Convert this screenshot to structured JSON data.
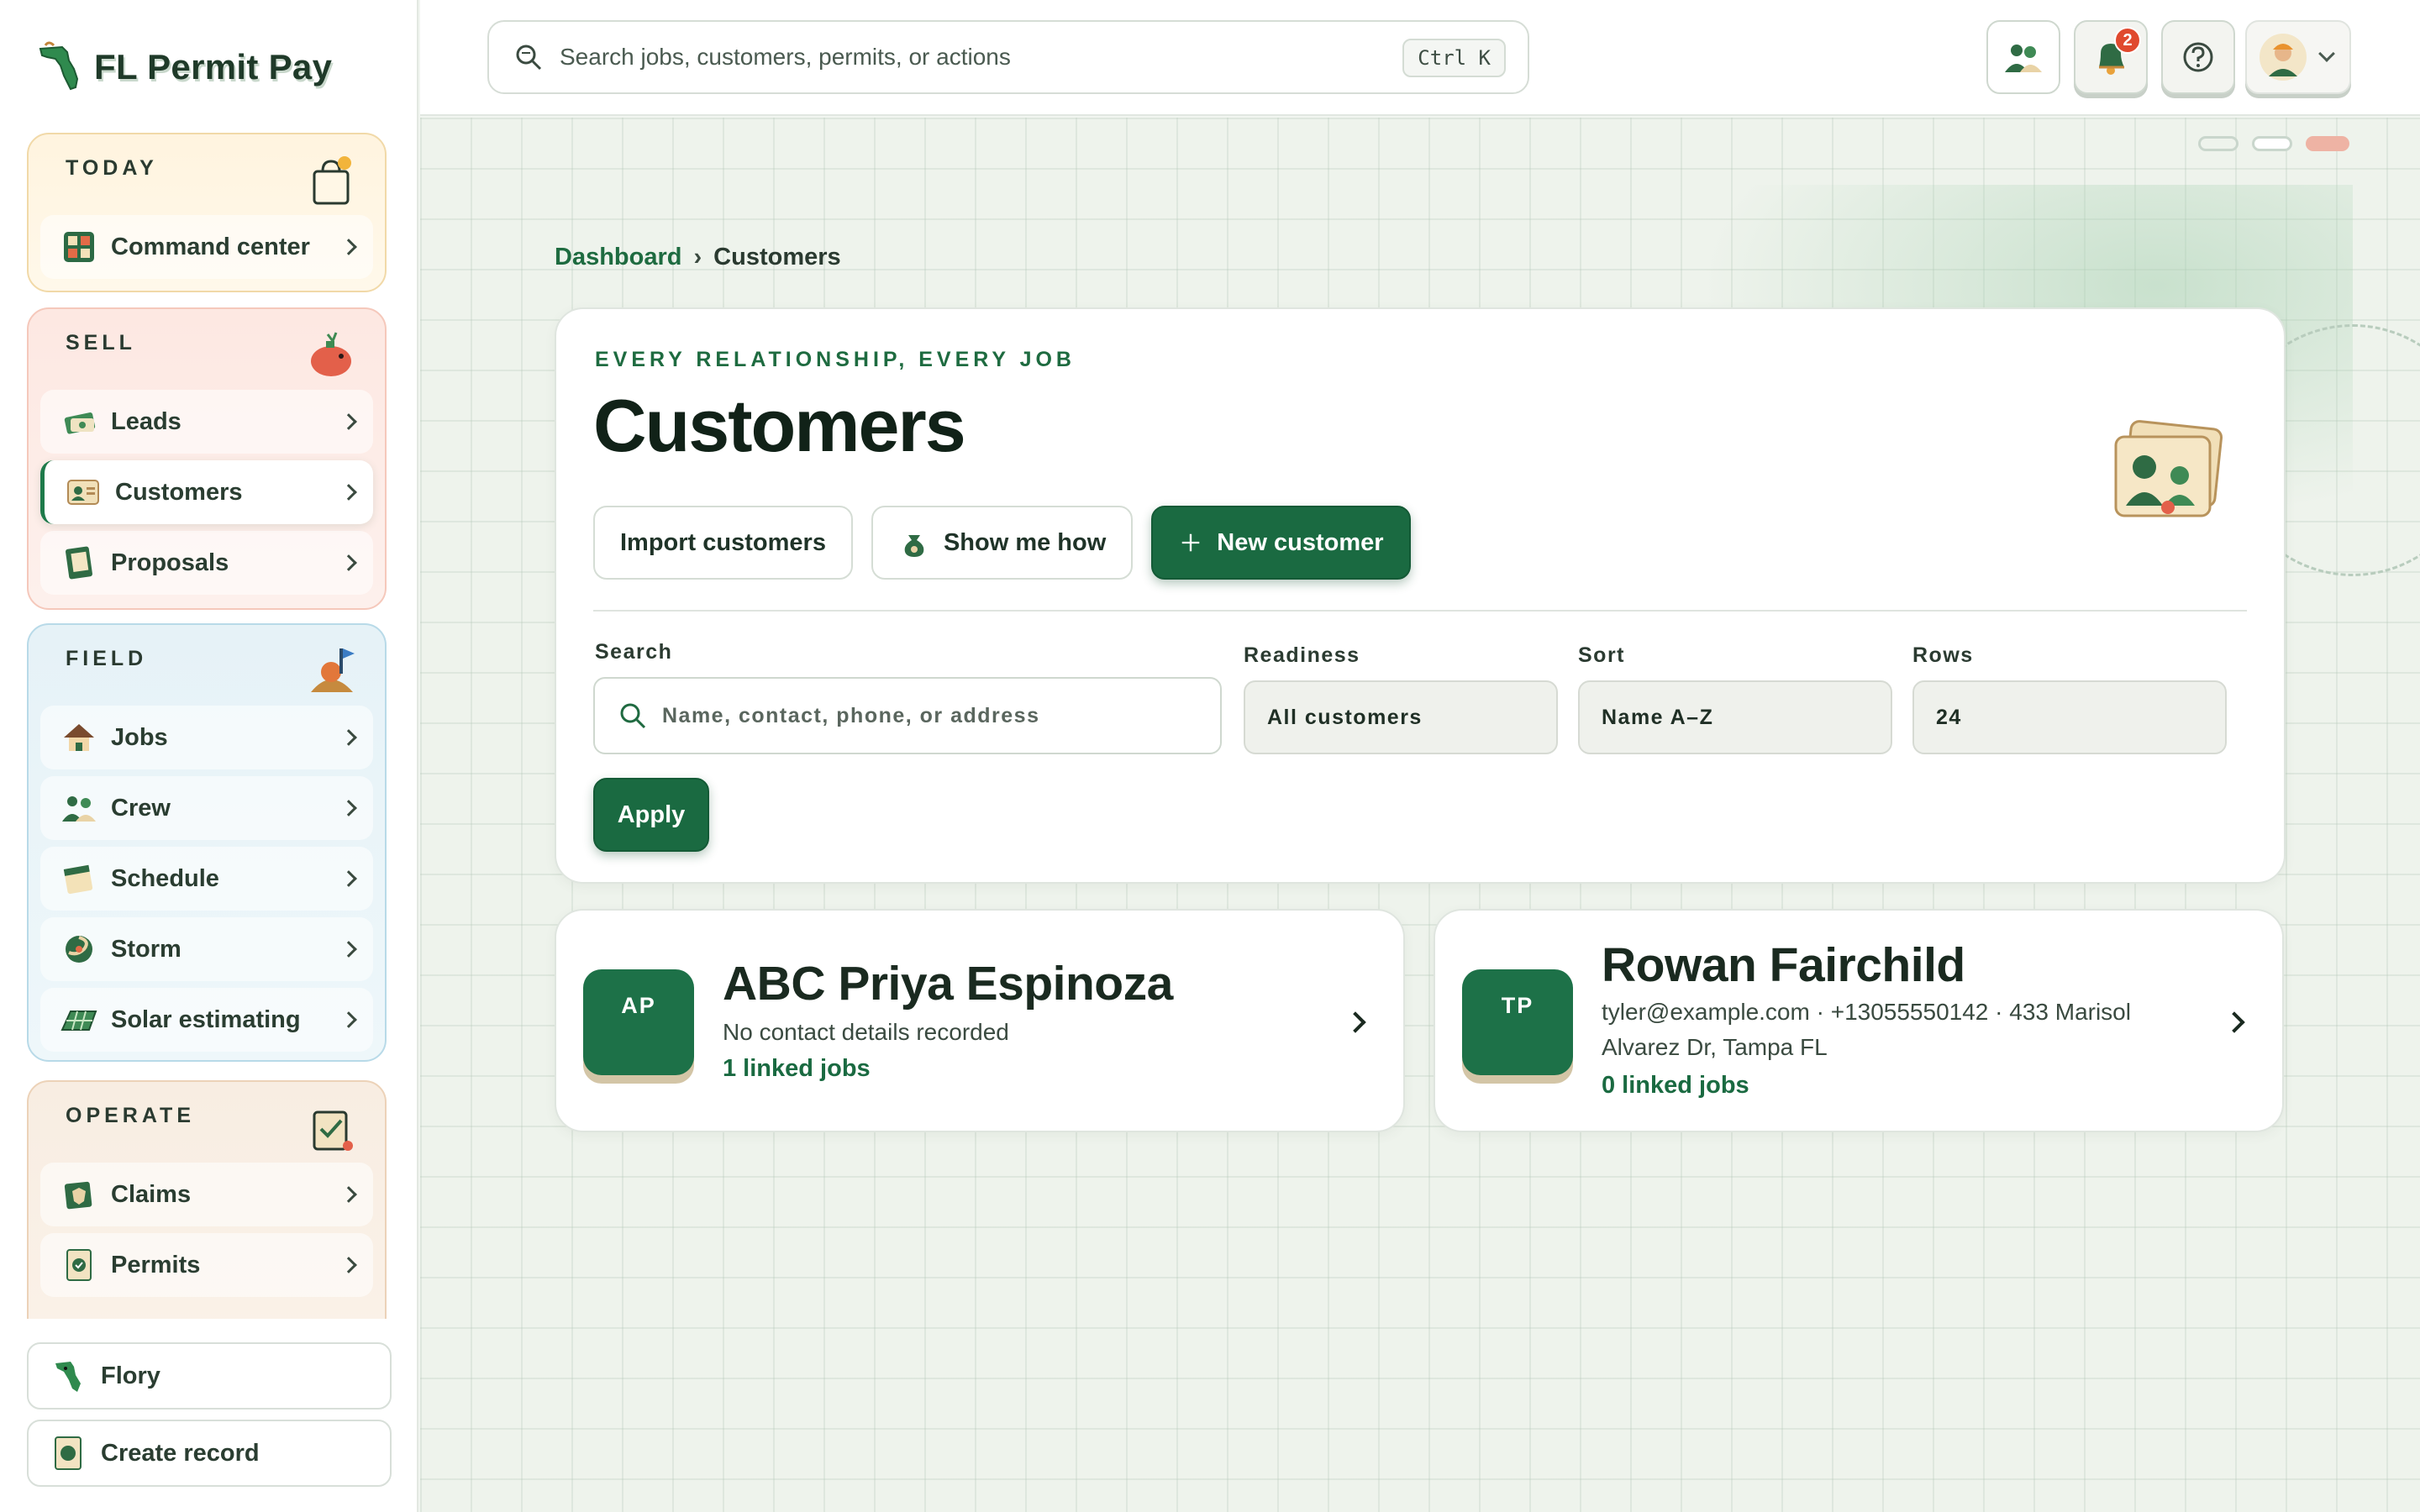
{
  "brand": {
    "name": "FL Permit Pay",
    "logo_icon": "florida-map-icon"
  },
  "sidebar": {
    "groups": [
      {
        "label": "TODAY",
        "icon": "shopping-bag-icon",
        "items": [
          {
            "label": "Command center",
            "icon": "dashboard-icon"
          }
        ]
      },
      {
        "label": "SELL",
        "icon": "piggy-bank-icon",
        "items": [
          {
            "label": "Leads",
            "icon": "money-icon"
          },
          {
            "label": "Customers",
            "icon": "contact-card-icon",
            "active": true
          },
          {
            "label": "Proposals",
            "icon": "notebook-icon"
          }
        ]
      },
      {
        "label": "FIELD",
        "icon": "construction-icon",
        "items": [
          {
            "label": "Jobs",
            "icon": "house-icon"
          },
          {
            "label": "Crew",
            "icon": "people-icon"
          },
          {
            "label": "Schedule",
            "icon": "calendar-icon"
          },
          {
            "label": "Storm",
            "icon": "hurricane-icon"
          },
          {
            "label": "Solar estimating",
            "icon": "solar-panel-icon"
          }
        ]
      },
      {
        "label": "OPERATE",
        "icon": "clipboard-icon",
        "items": [
          {
            "label": "Claims",
            "icon": "shield-folder-icon"
          },
          {
            "label": "Permits",
            "icon": "permit-badge-icon"
          }
        ]
      }
    ],
    "bottom": [
      {
        "label": "Flory",
        "icon": "florida-mascot-icon"
      },
      {
        "label": "Create record",
        "icon": "record-icon"
      }
    ]
  },
  "topbar": {
    "search_placeholder": "Search jobs, customers, permits, or actions",
    "shortcut": "Ctrl K",
    "notification_count": "2"
  },
  "breadcrumb": {
    "root": "Dashboard",
    "separator": "›",
    "current": "Customers"
  },
  "hero": {
    "eyebrow": "EVERY RELATIONSHIP, EVERY JOB",
    "title": "Customers",
    "actions": {
      "import": "Import customers",
      "tour": "Show me how",
      "new": "New customer"
    }
  },
  "filters": {
    "search_label": "Search",
    "search_placeholder": "Name, contact, phone, or address",
    "readiness_label": "Readiness",
    "readiness_value": "All customers",
    "sort_label": "Sort",
    "sort_value": "Name A–Z",
    "rows_label": "Rows",
    "rows_value": "24",
    "apply": "Apply"
  },
  "customers": [
    {
      "initials": "AP",
      "name": "ABC Priya Espinoza",
      "details": "No contact details recorded",
      "jobs": "1 linked jobs"
    },
    {
      "initials": "TP",
      "name": "Rowan Fairchild",
      "details": "tyler@example.com · +13055550142 · 433 Marisol Alvarez Dr, Tampa FL",
      "jobs": "0 linked jobs"
    }
  ],
  "colors": {
    "brand_green": "#1a6a41",
    "badge_red": "#e0492e"
  }
}
